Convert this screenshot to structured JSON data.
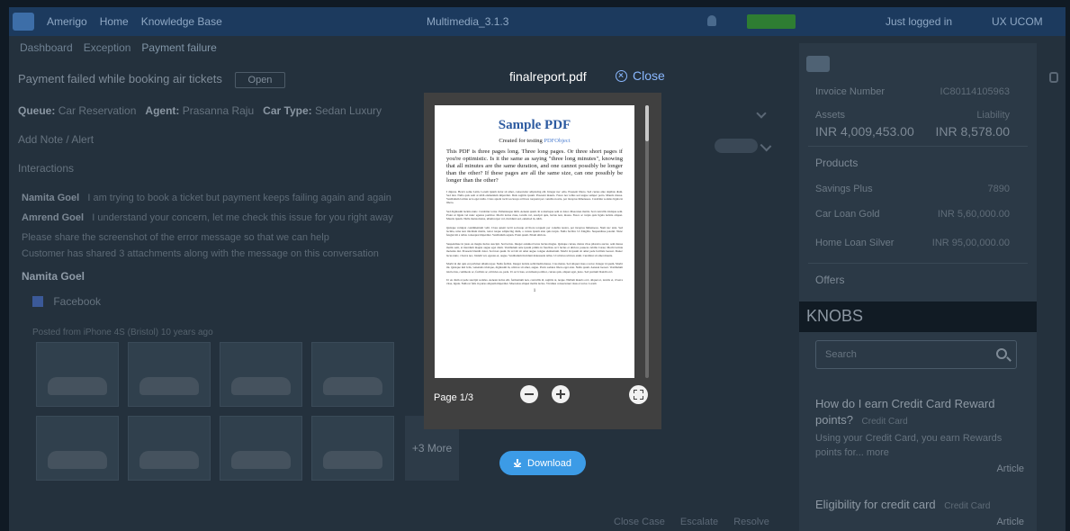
{
  "modal": {
    "filename": "finalreport.pdf",
    "close_label": "Close",
    "page_indicator": "Page 1/3",
    "download_label": "Download"
  },
  "pdf": {
    "title": "Sample PDF",
    "subtitle_prefix": "Created for testing",
    "subtitle_link": "PDFObject",
    "lead": "This PDF is three pages long. Three long pages. Or three short pages if you're optimistic. Is it the same as saying \"three long minutes\", knowing that all minutes are the same duration, and one cannot possibly be longer than the other? If these pages are all the same size, can one possibly be longer than the other?",
    "para1": "I digress. Here's some Latin. Lorem ipsum dolor sit amet, consectetur adipiscing elit. Integer nec odio. Praesent libero. Sed cursus ante dapibus diam. Sed nisi. Nulla quis sem at nibh elementum imperdiet. Duis sagittis ipsum. Praesent mauris. Fusce nec tellus sed augue semper porta. Mauris massa. Vestibulum lacinia arcu eget nulla. Class aptent taciti sociosqu ad litora torquent per conubia nostra, per inceptos himenaeos. Curabitur sodales ligula in libero.",
    "para2": "Sed dignissim lacinia nunc. Curabitur tortor. Pellentesque nibh. Aenean quam. In scelerisque sem at dolor. Maecenas mattis. Sed convallis tristique sem. Proin ut ligula vel nunc egestas porttitor. Morbi lectus risus, iaculis vel, suscipit quis, luctus non, massa. Fusce ac turpis quis ligula lacinia aliquet. Mauris ipsum. Nulla metus metus, ullamcorper vel, tincidunt sed, euismod in, nibh.",
    "para3": "Quisque volutpat condimentum velit. Class aptent taciti sociosqu ad litora torquent per conubia nostra, per inceptos himenaeos. Nam nec ante. Sed lacinia, urna non tincidunt mattis, tortor neque adipiscing diam, a cursus ipsum ante quis turpis. Nulla facilisi. Ut fringilla. Suspendisse potenti. Nunc feugiat mi a tellus consequat imperdiet. Vestibulum sapien. Proin quam. Etiam ultrices.",
    "para4": "Suspendisse in justo eu magna luctus suscipit. Sed lectus. Integer euismod lacus luctus magna. Quisque cursus, metus vitae pharetra auctor, sem massa mattis sem, at interdum magna augue eget diam. Vestibulum ante ipsum primis in faucibus orci luctus et ultrices posuere cubilia Curae; Morbi lacinia molestie dui. Praesent blandit dolor. Sed non quam. In vel mi sit amet augue congue elementum. Morbi in ipsum sit amet pede facilisis laoreet. Donec lacus nunc, viverra nec, blandit vel, egestas et, augue. Vestibulum tincidunt malesuada tellus. Ut ultrices ultrices enim. Curabitur sit amet mauris.",
    "para5": "Morbi in dui quis est pulvinar ullamcorper. Nulla facilisi. Integer lacinia sollicitudin massa. Cras metus. Sed aliquet risus a tortor. Integer id quam. Morbi mi. Quisque nisl felis, venenatis tristique, dignissim in, ultrices sit amet, augue. Proin sodales libero eget ante. Nulla quam. Aenean laoreet. Vestibulum nisi lectus, commodo ac, facilisis ac, ultricies eu, pede. Ut orci risus, accumsan porttitor, cursus quis, aliquet eget, justo. Sed pretium blandit orci.",
    "para6": "Ut eu diam at pede suscipit sodales. Aenean lectus elit, fermentum non, convallis id, sagittis at, neque. Nullam mauris orci, aliquet et, iaculis et, viverra vitae, ligula. Nulla ut felis in purus aliquam imperdiet. Maecenas aliquet mollis lectus. Vivamus consectetuer risus et tortor. Lorem",
    "page_number": "1"
  },
  "background": {
    "nav_items": [
      "Amerigo",
      "Home",
      "Knowledge Base"
    ],
    "center_header": "Multimedia_3.1.3",
    "user_status": "Just logged in",
    "user_code": "UX UCOM",
    "tabs": [
      "Dashboard",
      "Exception",
      "Payment failure"
    ],
    "ticket_title": "Payment failed while booking air tickets",
    "ticket_status": "Open",
    "queue_label": "Queue:",
    "queue_value": "Car Reservation",
    "agent_label": "Agent:",
    "agent_value": "Prasanna Raju",
    "cartype_label": "Car Type:",
    "cartype_value": "Sedan Luxury",
    "add_note": "Add Note / Alert",
    "interactions": "Interactions",
    "line1_name": "Namita Goel",
    "line1_text": "I am trying to book a ticket but payment keeps failing again and again",
    "line2_name": "Amrend Goel",
    "line2_text": "I understand your concern, let me check this issue for you right away",
    "line3_text": "Please share the screenshot of the error message so that we can help",
    "line4_text": "Customer has shared 3 attachments along with the message on this conversation",
    "person_name": "Namita Goel",
    "facebook": "Facebook",
    "posted_caption": "Posted from iPhone 4S (Bristol) 10 years ago",
    "more_tile": "+3 More",
    "bottom_links": [
      "Close Case",
      "Escalate",
      "Resolve"
    ],
    "right_panel": {
      "invoice_label": "Invoice Number",
      "invoice_value": "IC80114105963",
      "assets_label": "Assets",
      "assets_amount": "INR 4,009,453.00",
      "liability_label": "Liability",
      "liability_amount": "INR 8,578.00",
      "products": "Products",
      "product_rows": [
        {
          "name": "Savings Plus",
          "value": "7890"
        },
        {
          "name": "Car Loan Gold",
          "value": "INR 5,60,000.00"
        },
        {
          "name": "Home Loan Silver",
          "value": "INR 95,00,000.00"
        }
      ],
      "offers": "Offers",
      "kb_title": "KNOBS",
      "kb_search_placeholder": "Search",
      "kb_q1": "How do I earn Credit Card Reward points?",
      "kb_q1_tag": "Credit Card",
      "kb_a1": "Using your Credit Card, you earn Rewards points for... more",
      "kb_q1_more": "Article",
      "kb_q2": "Eligibility for credit card",
      "kb_q2_tag": "Credit Card",
      "kb_q2_more": "Article"
    }
  }
}
